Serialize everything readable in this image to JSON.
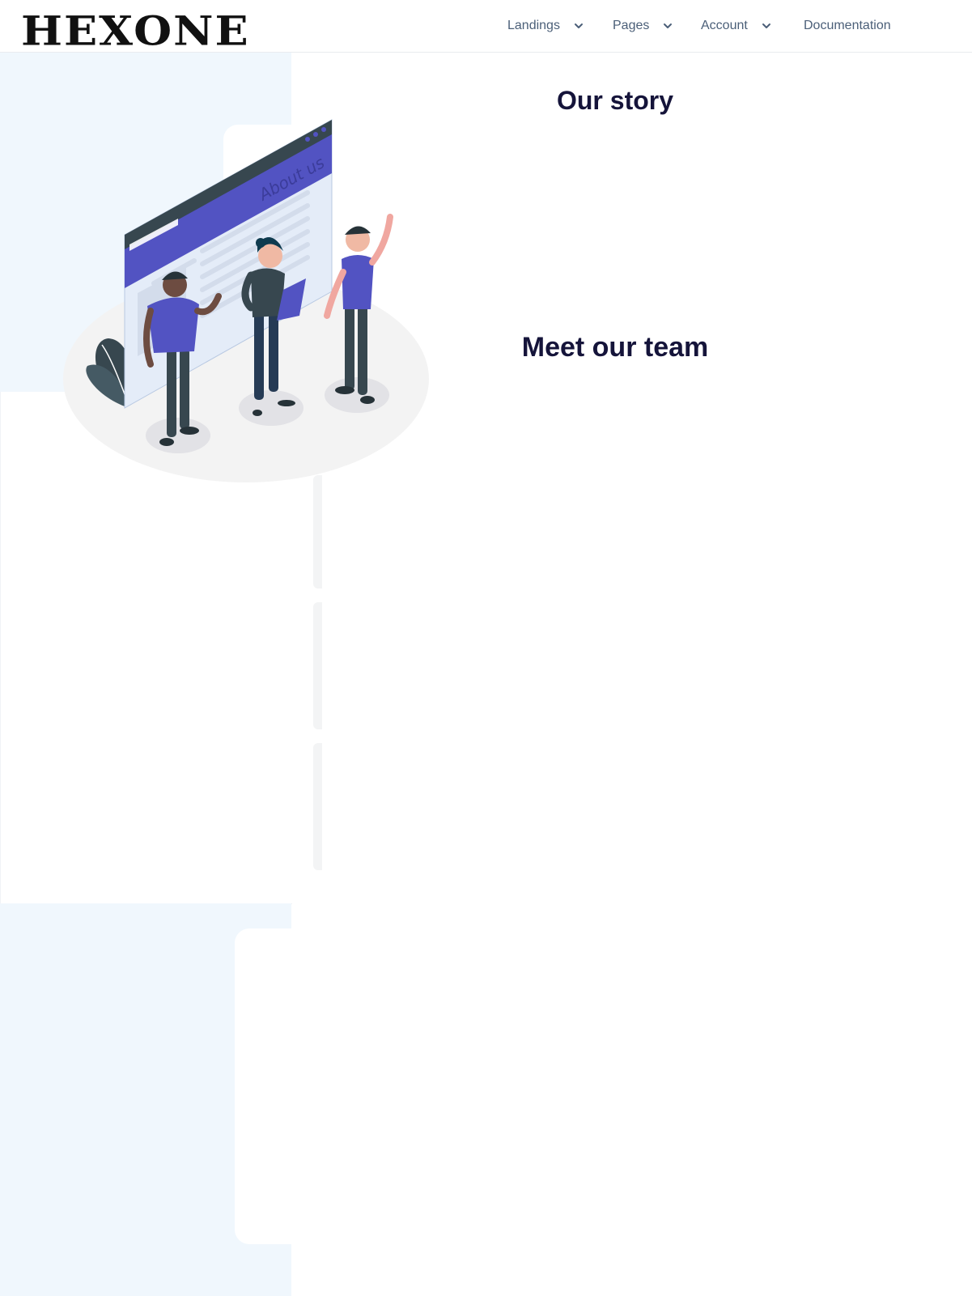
{
  "brand": {
    "logo_text": "HEXONE"
  },
  "nav": {
    "items": [
      {
        "label": "Landings",
        "has_dropdown": true
      },
      {
        "label": "Pages",
        "has_dropdown": true
      },
      {
        "label": "Account",
        "has_dropdown": true
      },
      {
        "label": "Documentation",
        "has_dropdown": false
      }
    ]
  },
  "story": {
    "title": "Our story"
  },
  "team": {
    "title": "Meet our team"
  },
  "illustration": {
    "screen_text": "About us",
    "icon": "team-about-us-illustration"
  },
  "colors": {
    "accent": "#5253c2",
    "heading": "#15143a",
    "nav_text": "#4b5f78",
    "panel_bg": "#f0f7fd"
  }
}
